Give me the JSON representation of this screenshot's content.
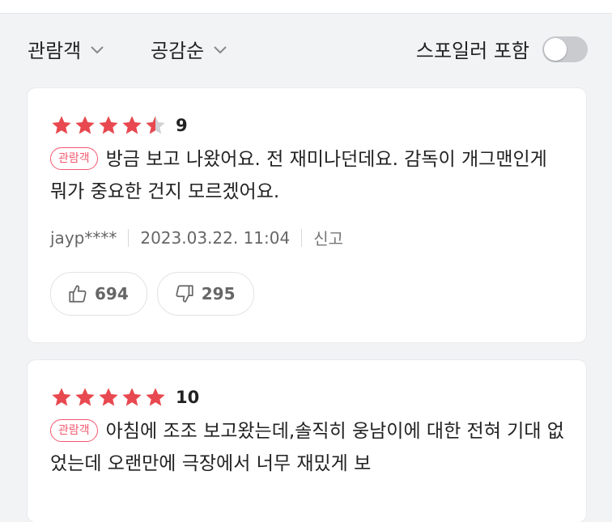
{
  "filters": {
    "audience_label": "관람객",
    "sort_label": "공감순",
    "spoiler_label": "스포일러 포함",
    "spoiler_enabled": false
  },
  "reviews": [
    {
      "rating_stars": 4.5,
      "score": "9",
      "badge": "관람객",
      "text": "방금 보고 나왔어요. 전 재미나던데요. 감독이 개그맨인게 뭐가 중요한 건지 모르겠어요.",
      "author": "jayp****",
      "date": "2023.03.22. 11:04",
      "report_label": "신고",
      "likes": "694",
      "dislikes": "295"
    },
    {
      "rating_stars": 5,
      "score": "10",
      "badge": "관람객",
      "text": "아침에 조조 보고왔는데,솔직히 웅남이에 대한 전혀 기대 없었는데 오랜만에 극장에서 너무 재밌게 보"
    }
  ],
  "colors": {
    "star": "#e8484f",
    "star_empty": "#cfd1d5",
    "badge": "#f3586e"
  },
  "icons": {
    "chevron": "chevron-down-icon",
    "thumbs_up": "thumbs-up-icon",
    "thumbs_down": "thumbs-down-icon",
    "star": "star-icon"
  }
}
